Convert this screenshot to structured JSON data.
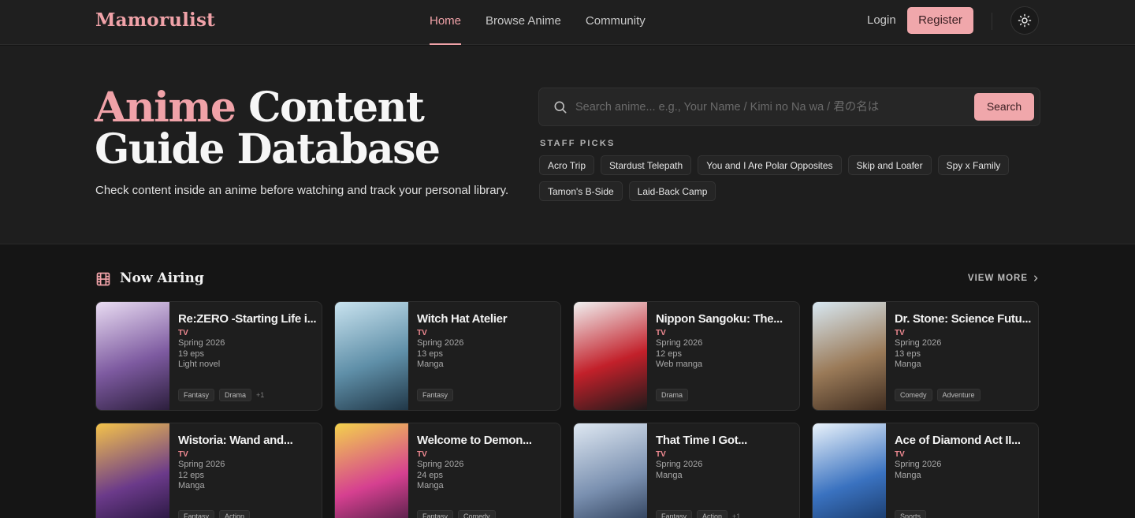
{
  "header": {
    "logo": "Mamorulist",
    "nav": [
      {
        "label": "Home",
        "active": true
      },
      {
        "label": "Browse Anime",
        "active": false
      },
      {
        "label": "Community",
        "active": false
      }
    ],
    "login_label": "Login",
    "register_label": "Register",
    "theme_icon": "sun-icon"
  },
  "hero": {
    "title_accent": "Anime",
    "title_rest_line1": "Content",
    "title_line2": "Guide Database",
    "subtitle": "Check content inside an anime before watching and track your personal library.",
    "search": {
      "placeholder": "Search anime... e.g., Your Name / Kimi no Na wa / 君の名は",
      "value": "",
      "button_label": "Search"
    },
    "staff_picks_label": "STAFF PICKS",
    "staff_picks": [
      "Acro Trip",
      "Stardust Telepath",
      "You and I Are Polar Opposites",
      "Skip and Loafer",
      "Spy x Family",
      "Tamon's B-Side",
      "Laid-Back Camp"
    ]
  },
  "section": {
    "title": "Now Airing",
    "view_more": "VIEW MORE",
    "cards": [
      {
        "title": "Re:ZERO -Starting Life i...",
        "type": "TV",
        "season": "Spring 2026",
        "eps": "19 eps",
        "source": "Light novel",
        "tags": [
          "Fantasy",
          "Drama"
        ],
        "more": "+1"
      },
      {
        "title": "Witch Hat Atelier",
        "type": "TV",
        "season": "Spring 2026",
        "eps": "13 eps",
        "source": "Manga",
        "tags": [
          "Fantasy"
        ],
        "more": ""
      },
      {
        "title": "Nippon Sangoku: The...",
        "type": "TV",
        "season": "Spring 2026",
        "eps": "12 eps",
        "source": "Web manga",
        "tags": [
          "Drama"
        ],
        "more": ""
      },
      {
        "title": "Dr. Stone: Science Futu...",
        "type": "TV",
        "season": "Spring 2026",
        "eps": "13 eps",
        "source": "Manga",
        "tags": [
          "Comedy",
          "Adventure"
        ],
        "more": ""
      },
      {
        "title": "Wistoria: Wand and...",
        "type": "TV",
        "season": "Spring 2026",
        "eps": "12 eps",
        "source": "Manga",
        "tags": [
          "Fantasy",
          "Action"
        ],
        "more": ""
      },
      {
        "title": "Welcome to Demon...",
        "type": "TV",
        "season": "Spring 2026",
        "eps": "24 eps",
        "source": "Manga",
        "tags": [
          "Fantasy",
          "Comedy"
        ],
        "more": ""
      },
      {
        "title": "That Time I Got...",
        "type": "TV",
        "season": "Spring 2026",
        "eps": "",
        "source": "Manga",
        "tags": [
          "Fantasy",
          "Action"
        ],
        "more": "+1"
      },
      {
        "title": "Ace of Diamond Act II...",
        "type": "TV",
        "season": "Spring 2026",
        "eps": "",
        "source": "Manga",
        "tags": [
          "Sports"
        ],
        "more": ""
      }
    ]
  },
  "colors": {
    "accent": "#f0a2a8",
    "background": "#151515",
    "panel": "#1e1e1e"
  }
}
